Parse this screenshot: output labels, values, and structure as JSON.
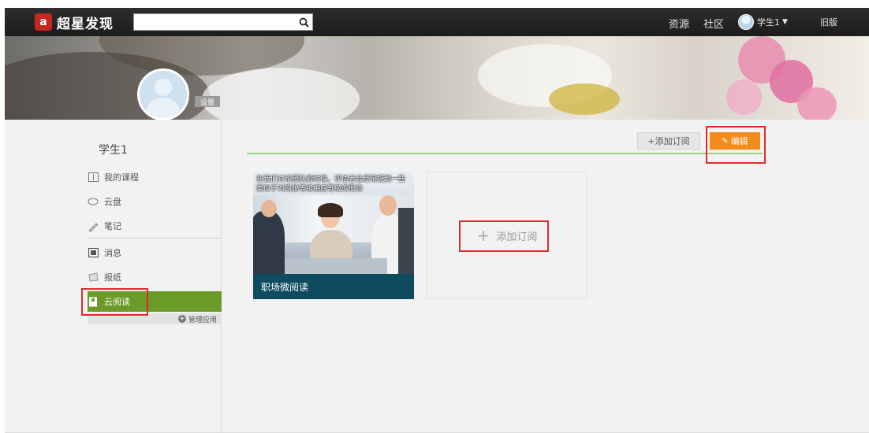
{
  "header": {
    "logo_mark": "a",
    "logo_text": "超星发现",
    "search_placeholder": "",
    "nav_resources": "资源",
    "nav_community": "社区",
    "user_name": "学生1",
    "nav_old_version": "旧版"
  },
  "profile": {
    "settings_label": "设置",
    "username": "学生1"
  },
  "sidebar": {
    "items": [
      {
        "label": "我的课程",
        "icon": "course-icon"
      },
      {
        "label": "云盘",
        "icon": "cloud-icon"
      },
      {
        "label": "笔记",
        "icon": "note-icon"
      },
      {
        "label": "消息",
        "icon": "message-icon"
      },
      {
        "label": "报纸",
        "icon": "newspaper-icon"
      },
      {
        "label": "云阅读",
        "icon": "book-icon"
      }
    ],
    "manage_apps": "管理应用"
  },
  "toolbar": {
    "add_subscription": "+添加订阅",
    "edit": "编辑"
  },
  "cards": {
    "workplace": {
      "description": "在我们讨论团队的时候，评估者会经常提到一些类似于对岗位等级相应等级的概念",
      "title": "职场微阅读"
    },
    "add_subscription": "添加订阅"
  },
  "colors": {
    "accent_orange": "#f28b1a",
    "active_green": "#6a9a27",
    "highlight_red": "#e02b2b",
    "card_title_bg": "#0f4b5e"
  }
}
